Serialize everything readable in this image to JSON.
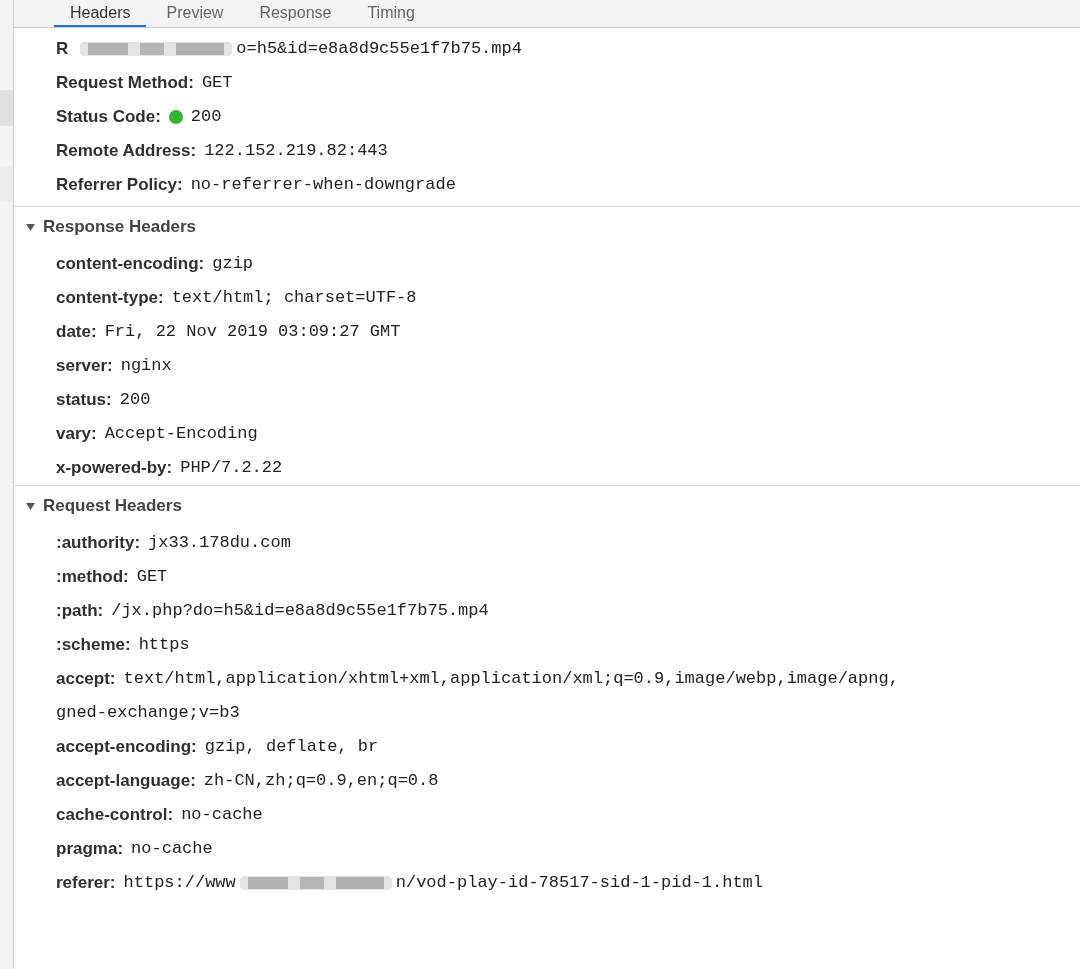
{
  "tabs": [
    {
      "label": "Headers",
      "selected": true
    },
    {
      "label": "Preview",
      "selected": false
    },
    {
      "label": "Response",
      "selected": false
    },
    {
      "label": "Timing",
      "selected": false
    }
  ],
  "general": [
    {
      "key": "R",
      "segments": [
        {
          "kind": "redacted"
        },
        {
          "kind": "text",
          "text": "o=h5&id=e8a8d9c55e1f7b75.mp4"
        }
      ]
    },
    {
      "key": "Request Method:",
      "segments": [
        {
          "kind": "text",
          "text": "GET"
        }
      ]
    },
    {
      "key": "Status Code:",
      "color": "#2fb52f",
      "segments": [
        {
          "kind": "text",
          "text": "200"
        }
      ]
    },
    {
      "key": "Remote Address:",
      "segments": [
        {
          "kind": "text",
          "text": "122.152.219.82:443"
        }
      ]
    },
    {
      "key": "Referrer Policy:",
      "segments": [
        {
          "kind": "text",
          "text": "no-referrer-when-downgrade"
        }
      ]
    }
  ],
  "sections": [
    {
      "title": "Response Headers",
      "expanded": true,
      "rows": [
        {
          "key": "content-encoding:",
          "segments": [
            {
              "kind": "text",
              "text": "gzip"
            }
          ]
        },
        {
          "key": "content-type:",
          "segments": [
            {
              "kind": "text",
              "text": "text/html; charset=UTF-8"
            }
          ]
        },
        {
          "key": "date:",
          "segments": [
            {
              "kind": "text",
              "text": "Fri, 22 Nov 2019 03:09:27 GMT"
            }
          ]
        },
        {
          "key": "server:",
          "segments": [
            {
              "kind": "text",
              "text": "nginx"
            }
          ]
        },
        {
          "key": "status:",
          "segments": [
            {
              "kind": "text",
              "text": "200"
            }
          ]
        },
        {
          "key": "vary:",
          "segments": [
            {
              "kind": "text",
              "text": "Accept-Encoding"
            }
          ]
        },
        {
          "key": "x-powered-by:",
          "segments": [
            {
              "kind": "text",
              "text": "PHP/7.2.22"
            }
          ]
        }
      ]
    },
    {
      "title": "Request Headers",
      "expanded": true,
      "rows": [
        {
          "key": ":authority:",
          "segments": [
            {
              "kind": "text",
              "text": "jx33.178du.com"
            }
          ]
        },
        {
          "key": ":method:",
          "segments": [
            {
              "kind": "text",
              "text": "GET"
            }
          ]
        },
        {
          "key": ":path:",
          "segments": [
            {
              "kind": "text",
              "text": "/jx.php?do=h5&id=e8a8d9c55e1f7b75.mp4"
            }
          ]
        },
        {
          "key": ":scheme:",
          "segments": [
            {
              "kind": "text",
              "text": "https"
            }
          ]
        },
        {
          "key": "accept:",
          "segments": [
            {
              "kind": "text",
              "text": "text/html,application/xhtml+xml,application/xml;q=0.9,image/webp,image/apng,"
            }
          ],
          "continuation": "gned-exchange;v=b3"
        },
        {
          "key": "accept-encoding:",
          "segments": [
            {
              "kind": "text",
              "text": "gzip, deflate, br"
            }
          ]
        },
        {
          "key": "accept-language:",
          "segments": [
            {
              "kind": "text",
              "text": "zh-CN,zh;q=0.9,en;q=0.8"
            }
          ]
        },
        {
          "key": "cache-control:",
          "segments": [
            {
              "kind": "text",
              "text": "no-cache"
            }
          ]
        },
        {
          "key": "pragma:",
          "segments": [
            {
              "kind": "text",
              "text": "no-cache"
            }
          ]
        },
        {
          "key": "referer:",
          "segments": [
            {
              "kind": "text",
              "text": "https://www"
            },
            {
              "kind": "redacted"
            },
            {
              "kind": "text",
              "text": "n/vod-play-id-78517-sid-1-pid-1.html"
            }
          ]
        }
      ]
    }
  ]
}
